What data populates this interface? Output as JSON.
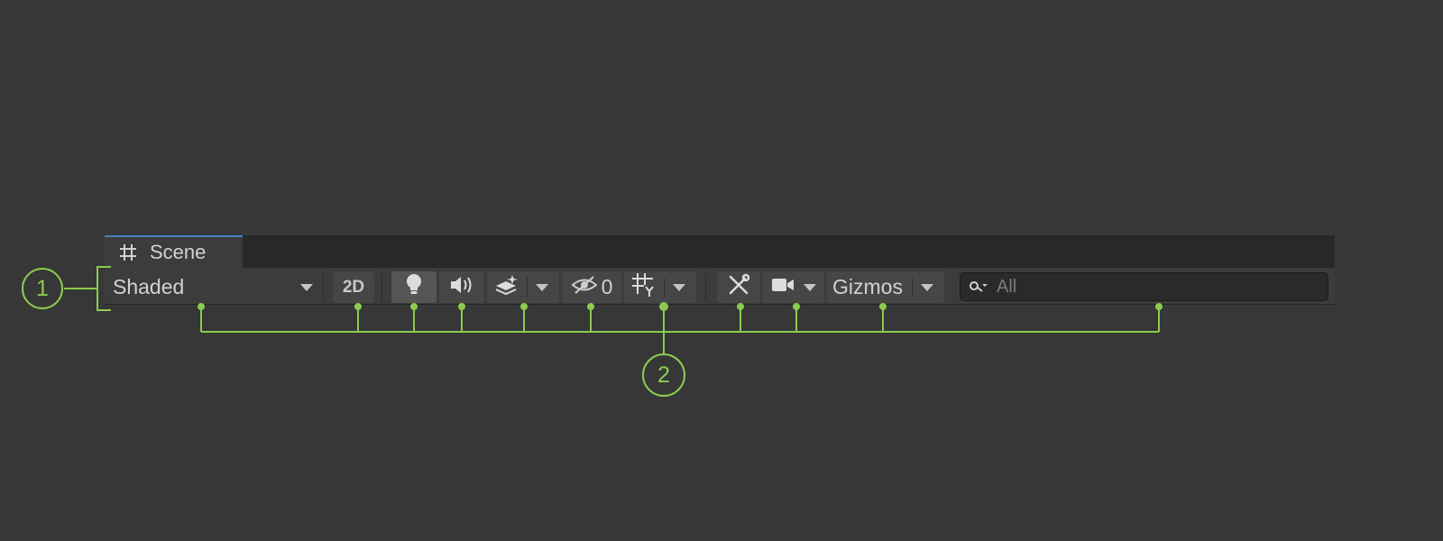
{
  "tab": {
    "label": "Scene",
    "icon": "grid-hash-icon"
  },
  "toolbar": {
    "draw_mode": {
      "value": "Shaded"
    },
    "mode_2d_label": "2D",
    "lighting_icon": "lightbulb-icon",
    "audio_icon": "speaker-icon",
    "effects_icon": "effects-layers-icon",
    "hidden_icon": "eye-slash-icon",
    "hidden_count": "0",
    "grid_icon": "grid-snap-icon",
    "tools_icon": "wrench-tools-icon",
    "camera_icon": "camera-icon",
    "gizmos_label": "Gizmos",
    "search": {
      "placeholder": "All",
      "value": ""
    }
  },
  "callouts": {
    "one": "1",
    "two": "2"
  },
  "colors": {
    "callout_green": "#8ccb4e",
    "tab_accent": "#4a7fc0",
    "background": "#373737"
  }
}
